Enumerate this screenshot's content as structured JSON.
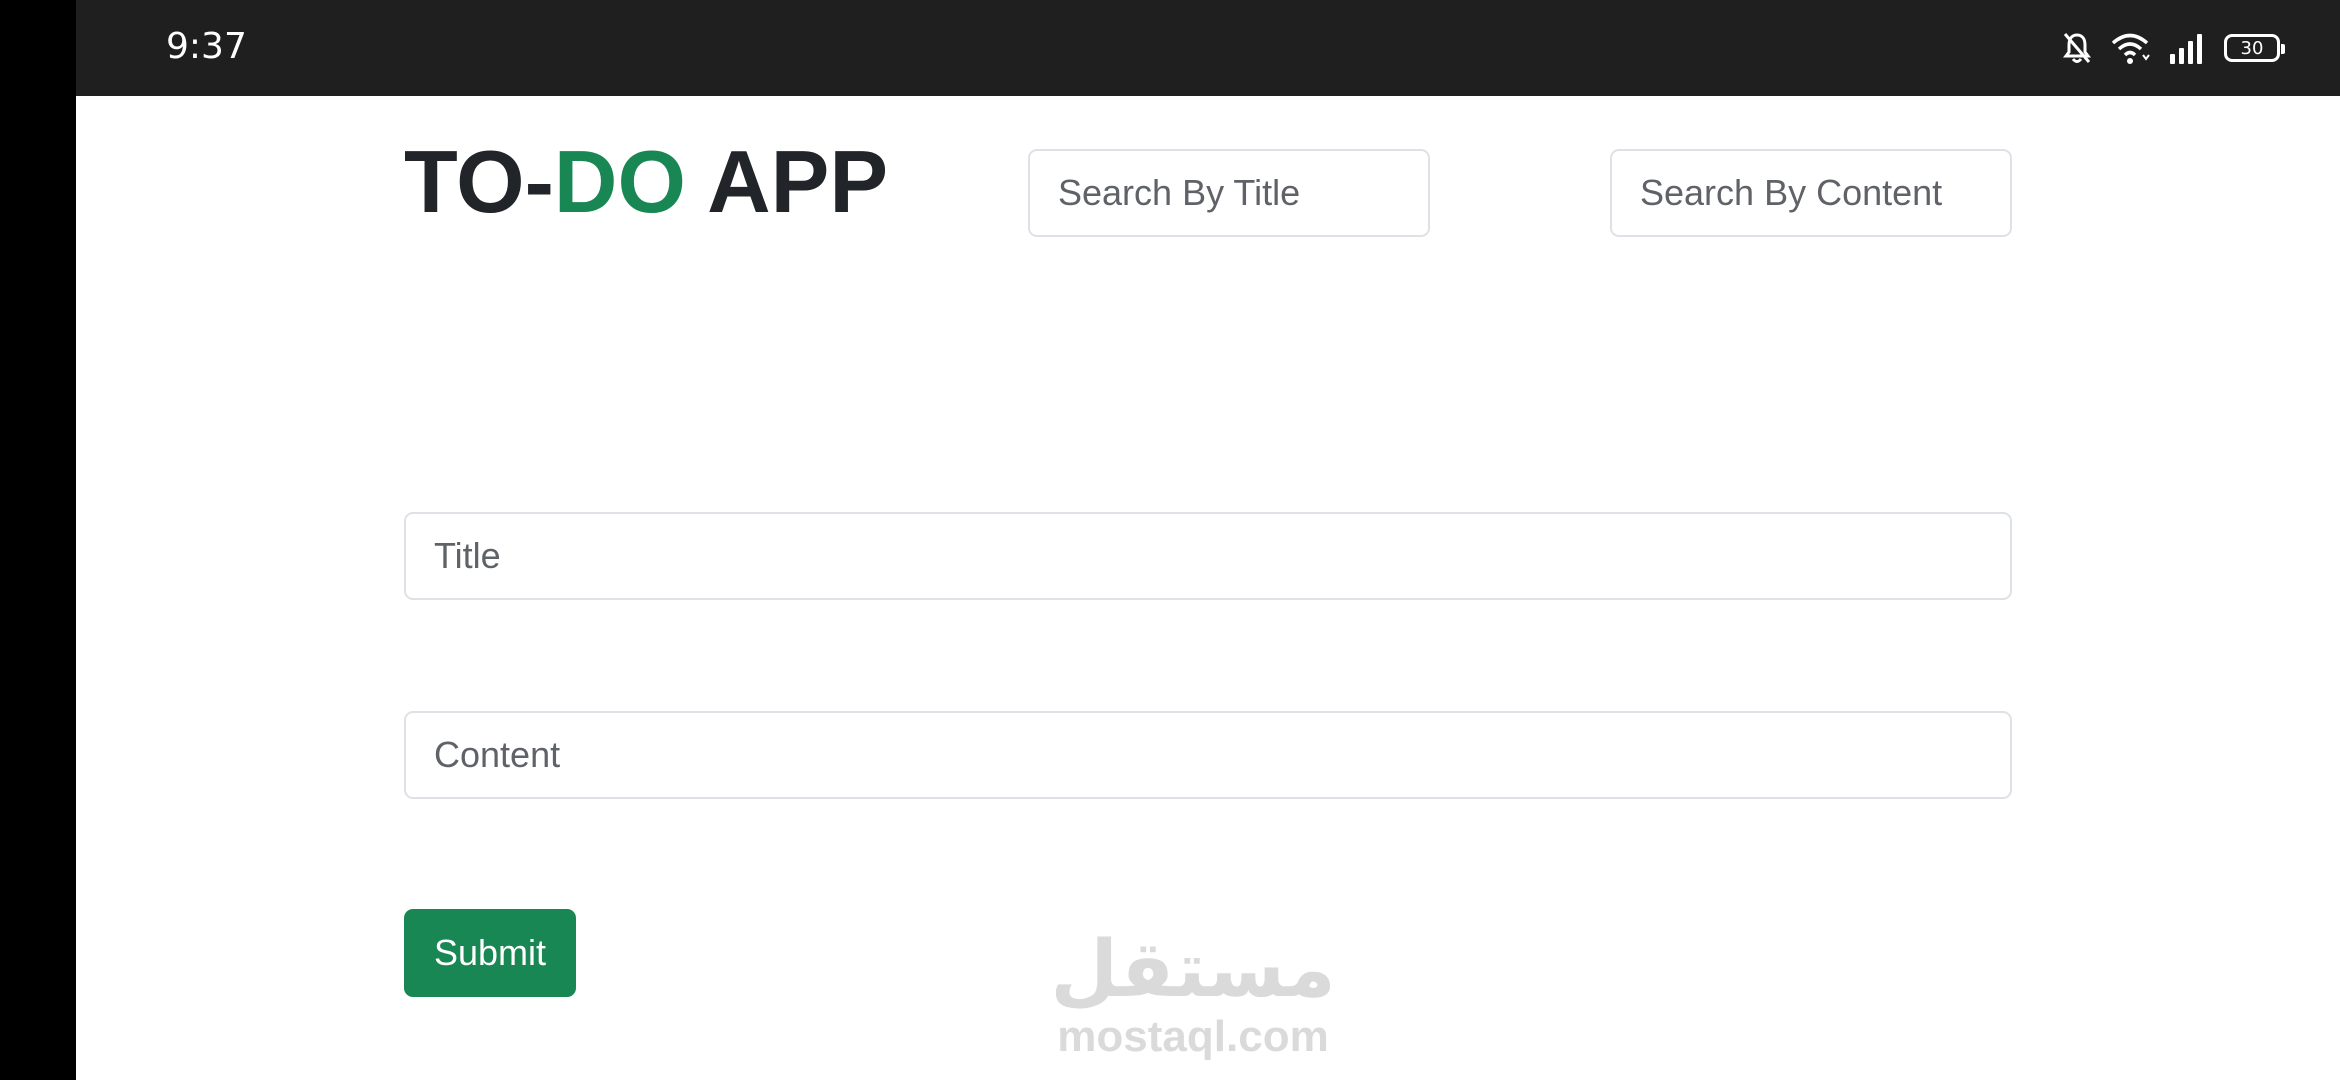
{
  "status_bar": {
    "time": "9:37",
    "battery_level": "30",
    "icons": [
      "bell-off-icon",
      "wifi-icon",
      "signal-icon",
      "battery-icon"
    ]
  },
  "header": {
    "title_prefix": "TO-",
    "title_accent": "DO",
    "title_suffix": " APP"
  },
  "search": {
    "title_placeholder": "Search By Title",
    "title_value": "",
    "content_placeholder": "Search By Content",
    "content_value": ""
  },
  "form": {
    "title_placeholder": "Title",
    "title_value": "",
    "content_placeholder": "Content",
    "content_value": "",
    "submit_label": "Submit"
  },
  "watermark": {
    "arabic": "مستقل",
    "latin": "mostaql.com"
  },
  "colors": {
    "accent": "#198754",
    "status_bar_bg": "#1f1f1f",
    "text_dark": "#212529"
  }
}
